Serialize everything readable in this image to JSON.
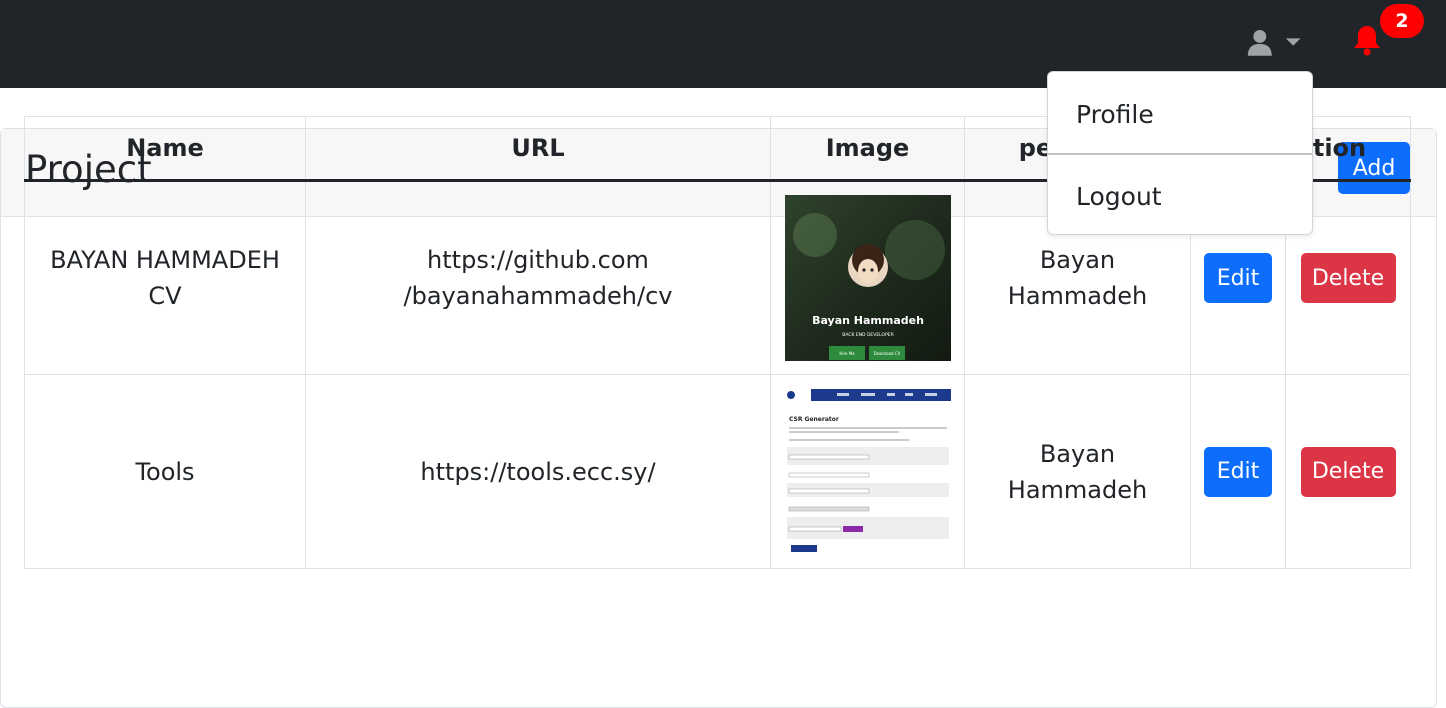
{
  "navbar": {
    "user_icon": "user-icon",
    "caret_icon": "caret-down-icon",
    "bell_icon": "bell-icon",
    "notification_count": "2",
    "bg_color": "#212529",
    "bell_color": "#ff0000"
  },
  "dropdown": {
    "items": [
      {
        "label": "Profile"
      },
      {
        "label": "Logout"
      }
    ]
  },
  "page": {
    "title": "Project",
    "add_label": "Add"
  },
  "table": {
    "headers": [
      "Name",
      "URL",
      "Image",
      "personal",
      "operation"
    ],
    "rows": [
      {
        "name": "BAYAN HAMMADEH CV",
        "url_line1": "https://github.com",
        "url_line2": "/bayanahammadeh/cv",
        "image_title": "Bayan Hammadeh",
        "image_subtitle": "BACK END DEVELOPER",
        "image_btn1": "Hire Me",
        "image_btn2": "Download CV",
        "personal_line1": "Bayan",
        "personal_line2": "Hammadeh",
        "edit_label": "Edit",
        "delete_label": "Delete"
      },
      {
        "name": "Tools",
        "url_line1": "https://tools.ecc.sy/",
        "image_title": "CSR Generator",
        "personal_line1": "Bayan",
        "personal_line2": "Hammadeh",
        "edit_label": "Edit",
        "delete_label": "Delete"
      }
    ]
  },
  "colors": {
    "primary": "#0d6efd",
    "danger": "#dc3545",
    "badge": "#ff0000"
  }
}
